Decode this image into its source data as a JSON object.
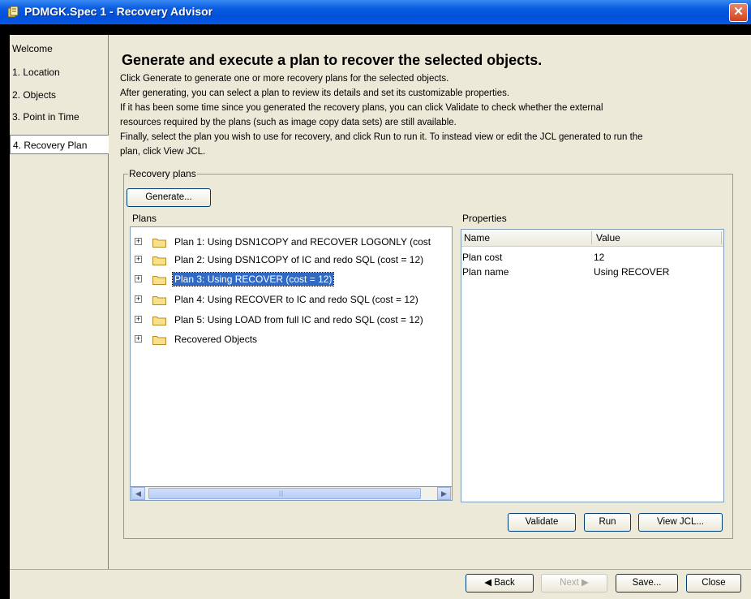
{
  "window": {
    "title": "PDMGK.Spec 1 - Recovery Advisor",
    "close_glyph": "✕"
  },
  "nav": {
    "items": [
      {
        "label": "Welcome"
      },
      {
        "label": "1. Location"
      },
      {
        "label": "2. Objects"
      },
      {
        "label": "3. Point in Time"
      },
      {
        "label": "4. Recovery Plan"
      }
    ]
  },
  "page": {
    "heading": "Generate and execute a plan to recover the selected objects.",
    "description": [
      "Click Generate to generate one or more recovery plans for the selected objects.",
      "After generating, you can select a plan to review its details and set its customizable properties.",
      "If it has been some time since you generated the recovery plans, you can click Validate to check whether the external",
      "resources required by the plans (such as image copy data sets) are still available.",
      "Finally, select the plan you wish to use for recovery, and click Run to run it. To instead view or edit the JCL generated to run the",
      "plan, click View JCL."
    ]
  },
  "recovery_plans": {
    "group_label": "Recovery plans",
    "generate_label": "Generate...",
    "plans_label": "Plans",
    "properties_label": "Properties",
    "tree": [
      {
        "label": "Plan 1: Using DSN1COPY and RECOVER LOGONLY (cost"
      },
      {
        "label": "Plan 2: Using DSN1COPY of IC and redo SQL (cost = 12)"
      },
      {
        "label": "Plan 3: Using RECOVER (cost = 12)"
      },
      {
        "label": "Plan 4: Using RECOVER to IC and redo SQL (cost = 12)"
      },
      {
        "label": "Plan 5: Using LOAD from full IC and redo SQL (cost = 12)"
      },
      {
        "label": "Recovered Objects"
      }
    ],
    "properties": {
      "columns": [
        "Name",
        "Value"
      ],
      "rows": [
        {
          "name": "Plan cost",
          "value": "12"
        },
        {
          "name": "Plan name",
          "value": "Using RECOVER"
        }
      ]
    },
    "validate_label": "Validate",
    "run_label": "Run",
    "viewjcl_label": "View JCL..."
  },
  "footer": {
    "back_label": "◀ Back",
    "next_label": "Next ▶",
    "save_label": "Save...",
    "close_label": "Close"
  }
}
